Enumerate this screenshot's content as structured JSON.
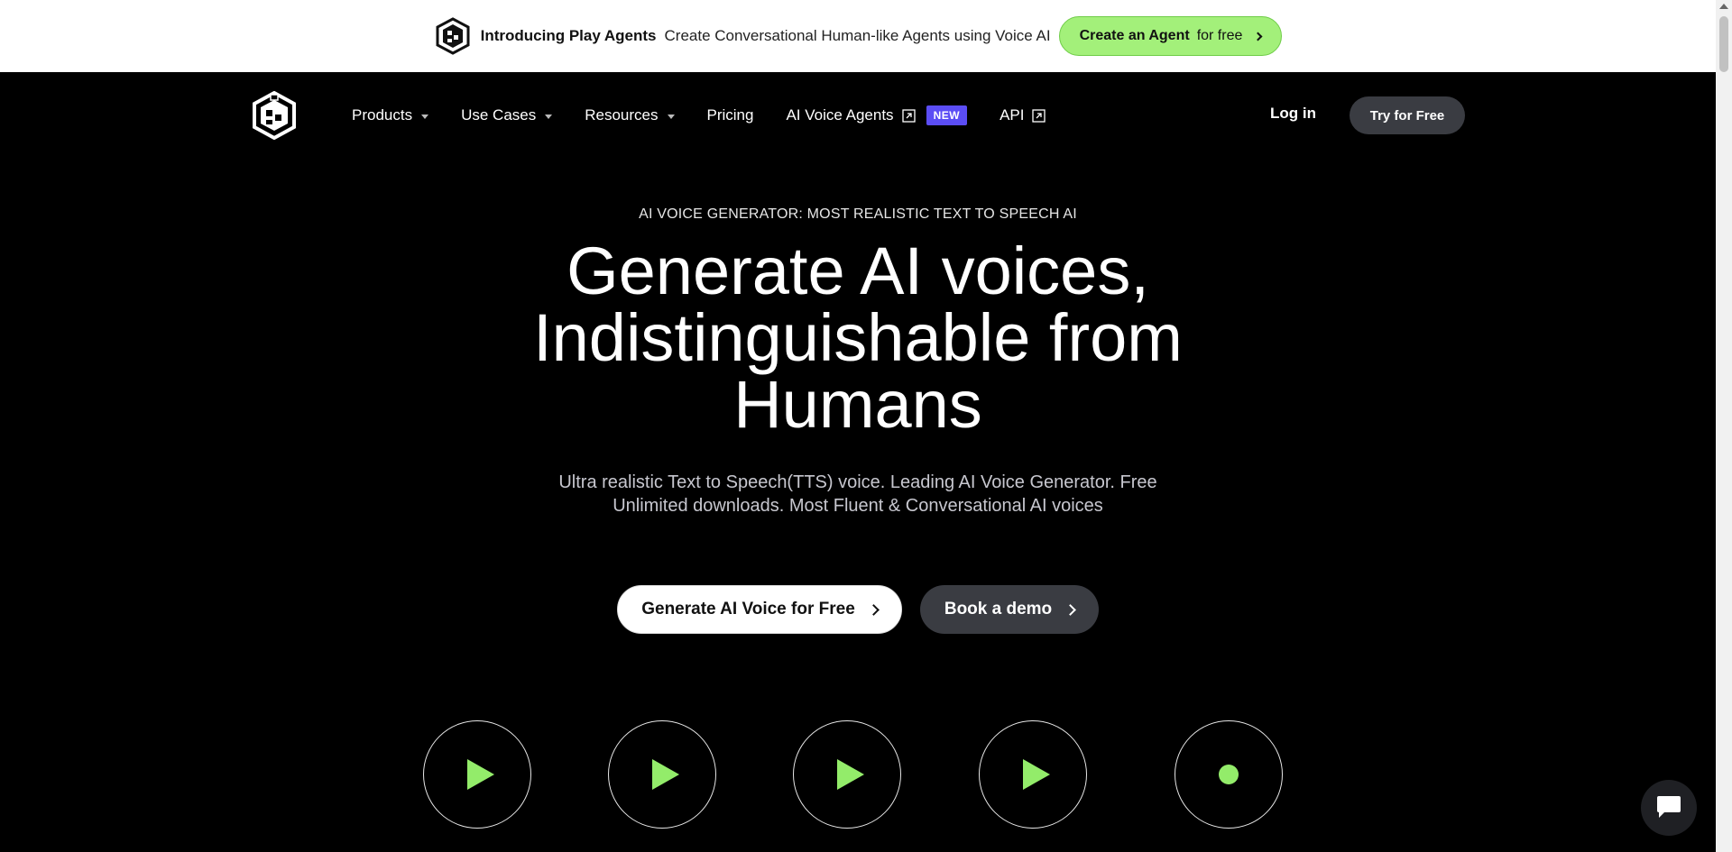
{
  "announcement": {
    "title": "Introducing Play Agents",
    "text": "Create Conversational Human-like Agents using Voice AI",
    "cta_bold": "Create an Agent",
    "cta_rest": "for free",
    "cta_color": "#a3f07a"
  },
  "nav": {
    "items": [
      {
        "label": "Products",
        "has_dropdown": true
      },
      {
        "label": "Use Cases",
        "has_dropdown": true
      },
      {
        "label": "Resources",
        "has_dropdown": true
      },
      {
        "label": "Pricing"
      },
      {
        "label": "AI Voice Agents",
        "external": true,
        "badge": "NEW"
      },
      {
        "label": "API",
        "external": true
      }
    ],
    "login": "Log in",
    "try": "Try for Free",
    "badge_color": "#5b4df5"
  },
  "hero": {
    "eyebrow": "AI VOICE GENERATOR: MOST REALISTIC TEXT TO SPEECH AI",
    "headline_line1": "Generate AI voices,",
    "headline_line2": "Indistinguishable from",
    "headline_line3": "Humans",
    "subtext_line1": "Ultra realistic Text to Speech(TTS) voice. Leading AI Voice Generator. Free",
    "subtext_line2": "Unlimited downloads. Most Fluent & Conversational AI voices",
    "primary_button": "Generate AI Voice for Free",
    "secondary_button": "Book a demo"
  },
  "voice_players": [
    {
      "icon": "play-icon"
    },
    {
      "icon": "play-icon"
    },
    {
      "icon": "play-icon"
    },
    {
      "icon": "play-icon"
    },
    {
      "icon": "record-dot-icon"
    }
  ],
  "accent_color": "#93ec6a"
}
